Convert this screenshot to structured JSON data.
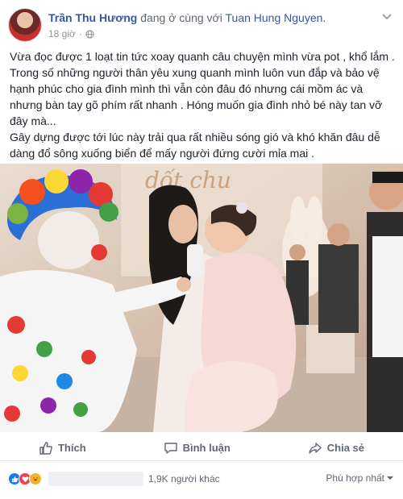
{
  "header": {
    "author": "Trần Thu Hương",
    "with_text": "đang ở cùng với",
    "tagged": "Tuan Hung Nguyen.",
    "time": "18 giờ",
    "privacy_icon": "globe-icon",
    "menu_icon": "chevron-down-icon"
  },
  "post": {
    "paragraph1": "Vừa đọc được 1 loạt tin tức xoay quanh câu chuyện mình vừa pot , khổ lắm . Trong số những người thân yêu xung quanh mình luôn vun đắp và bảo vệ hạnh phúc cho gia đình mình thì vẫn còn đâu đó nhưng cái mồm ác và nhưng bàn tay gõ phím rất nhanh . Hóng muốn gia đình nhỏ bé này tan vỡ đây mà...",
    "paragraph2": "Gây dựng được tới lúc này trải qua rất nhiều sóng gió và khó khăn đâu dễ dàng đổ sông xuống biển để mấy người đứng cười mỉa mai ."
  },
  "photo": {
    "sign_text": "dốt chu"
  },
  "actions": {
    "like": "Thích",
    "comment": "Bình luận",
    "share": "Chia sẻ"
  },
  "reactions": {
    "count_text": "1,9K người khác",
    "sort_label": "Phù hợp nhất",
    "colors": {
      "like": "#1877f2",
      "love": "#f33e58",
      "haha": "#f7b125"
    }
  }
}
